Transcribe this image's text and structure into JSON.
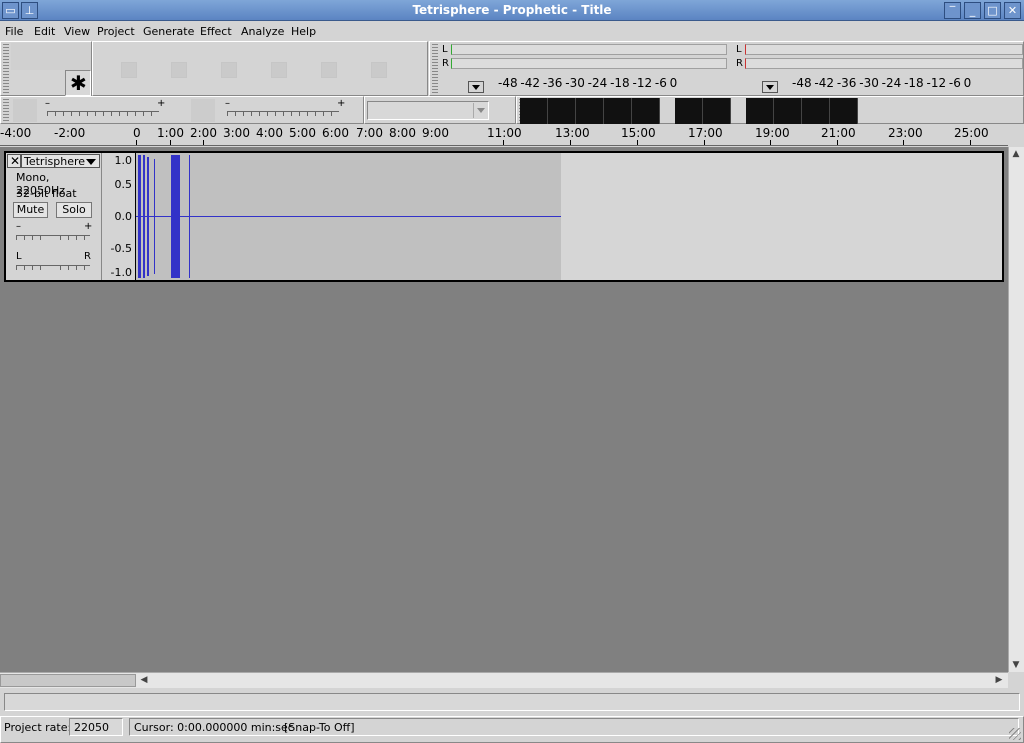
{
  "window": {
    "title": "Tetrisphere - Prophetic - Title",
    "buttons": {
      "menu": "▭",
      "pin": "📌",
      "minimize": "▁",
      "restore": "▂",
      "maximize": "□",
      "close": "✕"
    }
  },
  "menu": [
    {
      "label": "File"
    },
    {
      "label": "Edit"
    },
    {
      "label": "View"
    },
    {
      "label": "Project"
    },
    {
      "label": "Generate"
    },
    {
      "label": "Effect"
    },
    {
      "label": "Analyze"
    },
    {
      "label": "Help"
    }
  ],
  "tools": {
    "multi_tool_glyph": "✱"
  },
  "meters": {
    "play": {
      "left": "L",
      "right": "R",
      "scale": "-48   -42   -36   -30   -24   -18   -12    -6     0"
    },
    "record": {
      "left": "L",
      "right": "R",
      "scale": "-48   -42   -36   -30   -24   -18   -12    -6     0"
    }
  },
  "mixer": {
    "output_minus": "–",
    "output_plus": "+",
    "input_minus": "–",
    "input_plus": "+"
  },
  "ruler": {
    "labels": [
      "-4:00",
      "-2:00",
      "0",
      "1:00",
      "2:00",
      "3:00",
      "4:00",
      "5:00",
      "6:00",
      "7:00",
      "8:00",
      "9:00",
      "11:00",
      "13:00",
      "15:00",
      "17:00",
      "19:00",
      "21:00",
      "23:00",
      "25:00"
    ]
  },
  "track": {
    "name": "Tetrisphere",
    "format": "Mono, 22050Hz",
    "bitdepth": "32-bit float",
    "mute": "Mute",
    "solo": "Solo",
    "gain_minus": "–",
    "gain_plus": "+",
    "pan_left": "L",
    "pan_right": "R",
    "vruler": [
      "1.0",
      "0.5",
      "0.0",
      "-0.5",
      "-1.0"
    ],
    "waveform_color": "#3232c8"
  },
  "status": {
    "rate_label": "Project rate:",
    "rate_value": "22050",
    "cursor": "Cursor: 0:00.000000 min:sec",
    "snap": "[Snap-To Off]"
  }
}
